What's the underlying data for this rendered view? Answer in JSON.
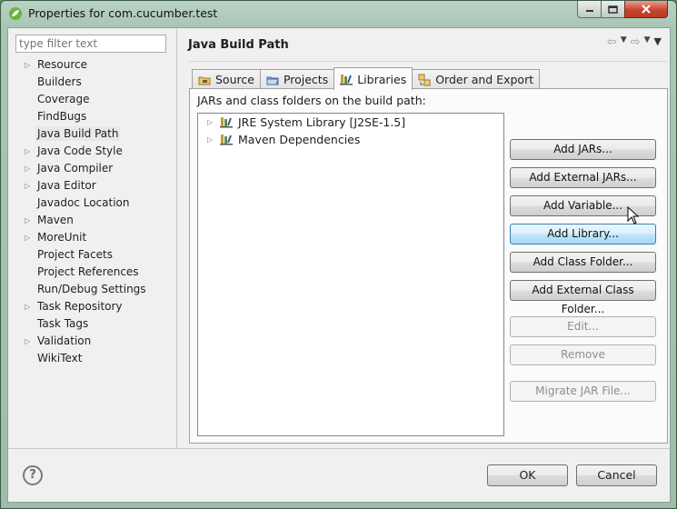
{
  "window": {
    "title": "Properties for com.cucumber.test"
  },
  "filter": {
    "placeholder": "type filter text"
  },
  "nav": {
    "items": [
      {
        "label": "Resource",
        "expandable": true
      },
      {
        "label": "Builders",
        "expandable": false
      },
      {
        "label": "Coverage",
        "expandable": false
      },
      {
        "label": "FindBugs",
        "expandable": false
      },
      {
        "label": "Java Build Path",
        "expandable": false,
        "selected": true
      },
      {
        "label": "Java Code Style",
        "expandable": true
      },
      {
        "label": "Java Compiler",
        "expandable": true
      },
      {
        "label": "Java Editor",
        "expandable": true
      },
      {
        "label": "Javadoc Location",
        "expandable": false
      },
      {
        "label": "Maven",
        "expandable": true
      },
      {
        "label": "MoreUnit",
        "expandable": true
      },
      {
        "label": "Project Facets",
        "expandable": false
      },
      {
        "label": "Project References",
        "expandable": false
      },
      {
        "label": "Run/Debug Settings",
        "expandable": false
      },
      {
        "label": "Task Repository",
        "expandable": true
      },
      {
        "label": "Task Tags",
        "expandable": false
      },
      {
        "label": "Validation",
        "expandable": true
      },
      {
        "label": "WikiText",
        "expandable": false
      }
    ]
  },
  "page": {
    "title": "Java Build Path"
  },
  "tabs": [
    {
      "label": "Source",
      "icon": "source-folder-icon"
    },
    {
      "label": "Projects",
      "icon": "projects-folder-icon"
    },
    {
      "label": "Libraries",
      "icon": "libraries-icon",
      "active": true
    },
    {
      "label": "Order and Export",
      "icon": "order-export-icon"
    }
  ],
  "libraries": {
    "label": "JARs and class folders on the build path:",
    "items": [
      {
        "label": "JRE System Library [J2SE-1.5]"
      },
      {
        "label": "Maven Dependencies"
      }
    ]
  },
  "buttons": {
    "add_jars": "Add JARs...",
    "add_external_jars": "Add External JARs...",
    "add_variable": "Add Variable...",
    "add_library": "Add Library...",
    "add_class_folder": "Add Class Folder...",
    "add_external_class_folder": "Add External Class Folder...",
    "edit": "Edit...",
    "remove": "Remove",
    "migrate_jar": "Migrate JAR File..."
  },
  "dialog": {
    "ok": "OK",
    "cancel": "Cancel",
    "help": "?"
  },
  "colors": {
    "hover_button": "#bee6fd",
    "title_bar": "#a9c6b5",
    "close_button": "#c9452c"
  }
}
